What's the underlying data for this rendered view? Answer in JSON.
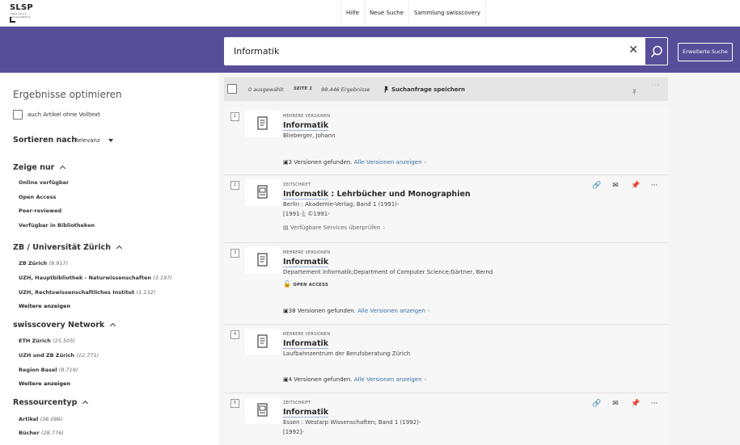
{
  "logo": {
    "brand": "SLSP",
    "sub": "Swiss Library Service Platform"
  },
  "topnav": [
    "Hilfe",
    "Neue Suche",
    "Sammlung swisscovery"
  ],
  "search": {
    "value": "Informatik",
    "advanced_label": "Erweiterte Suche"
  },
  "sidebar": {
    "title": "Ergebnisse optimieren",
    "fulltext_label": "auch Artikel ohne Volltext",
    "sort_label": "Sortieren nach",
    "sort_value": "Relevanz",
    "show_only": {
      "title": "Zeige nur",
      "items": [
        "Online verfügbar",
        "Open Access",
        "Peer-reviewed",
        "Verfügbar in Bibliotheken"
      ]
    },
    "zb": {
      "title": "ZB / Universität Zürich",
      "items": [
        {
          "label": "ZB Zürich",
          "count": "(9.917)"
        },
        {
          "label": "UZH, Hauptbibliothek - Naturwissenschaften",
          "count": "(3.197)"
        },
        {
          "label": "UZH, Rechtswissenschaftliches Institut",
          "count": "(1.132)"
        }
      ],
      "more": "Weitere anzeigen"
    },
    "network": {
      "title": "swisscovery Network",
      "items": [
        {
          "label": "ETH Zürich",
          "count": "(25.505)"
        },
        {
          "label": "UZH und ZB Zürich",
          "count": "(12.771)"
        },
        {
          "label": "Region Basel",
          "count": "(8.719)"
        }
      ],
      "more": "Weitere anzeigen"
    },
    "restype": {
      "title": "Ressourcentyp",
      "items": [
        {
          "label": "Artikel",
          "count": "(36.086)"
        },
        {
          "label": "Bücher",
          "count": "(28.776)"
        }
      ]
    }
  },
  "resultsbar": {
    "selected": "0 ausgewählt",
    "page": "SEITE 1",
    "total": "99.446 Ergebnisse",
    "save_query": "Suchanfrage speichern"
  },
  "results": [
    {
      "num": "1",
      "type": "MEHRERE VERSIONEN",
      "title_hl": "Informatik",
      "title_rest": "",
      "lines": [
        "Blieberger, Johann"
      ],
      "versions": "3 Versionen gefunden.",
      "versions_link": "Alle Versionen anzeigen"
    },
    {
      "num": "2",
      "type": "ZEITSCHRIFT",
      "title_hl": "Informatik",
      "title_rest": " : Lehrbücher und Monographien",
      "lines": [
        "Berlin : Akademie-Verlag; Band 1 (1991)-",
        "[1991-]; ©1991-"
      ],
      "services": "Verfügbare Services überprüfen"
    },
    {
      "num": "3",
      "type": "MEHRERE VERSIONEN",
      "title_hl": "Informatik",
      "title_rest": "",
      "lines": [
        "Departement Informatik;Department of Computer Science;Gärtner, Bernd"
      ],
      "open_access": "OPEN ACCESS",
      "versions": "38 Versionen gefunden.",
      "versions_link": "Alle Versionen anzeigen"
    },
    {
      "num": "4",
      "type": "MEHRERE VERSIONEN",
      "title_hl": "Informatik",
      "title_rest": "",
      "lines": [
        "Laufbahnzentrum der Berufsberatung Zürich"
      ],
      "versions": "4 Versionen gefunden.",
      "versions_link": "Alle Versionen anzeigen"
    },
    {
      "num": "5",
      "type": "ZEITSCHRIFT",
      "title_hl": "Informatik",
      "title_rest": "",
      "lines": [
        "Essen : Westarp Wissenschaften; Band 1 (1992)-",
        "[1992]-"
      ]
    }
  ]
}
